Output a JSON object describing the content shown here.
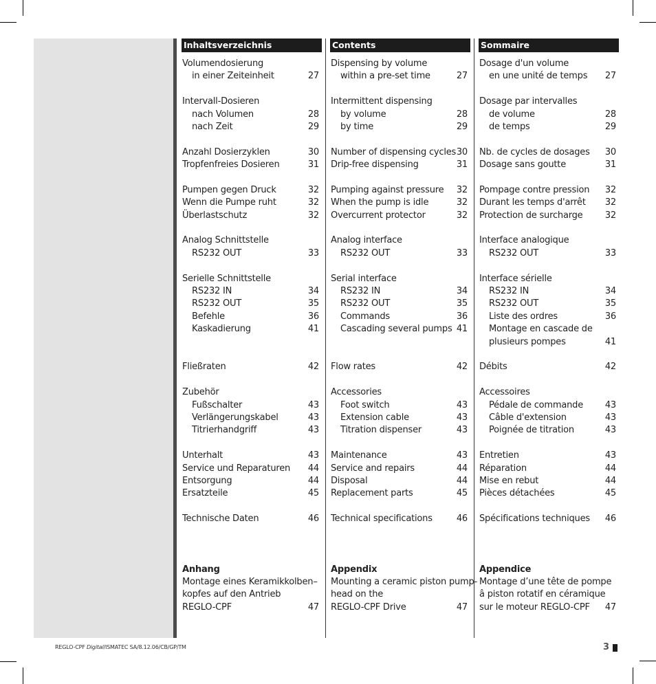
{
  "columns": [
    {
      "header": "Inhaltsverzeichnis",
      "rows": [
        {
          "text": "Volumendosierung",
          "page": ""
        },
        {
          "text": "in einer Zeiteinheit",
          "page": "27",
          "sub": true
        },
        {
          "gap": true
        },
        {
          "text": "Intervall-Dosieren",
          "page": ""
        },
        {
          "text": "nach Volumen",
          "page": "28",
          "sub": true
        },
        {
          "text": "nach Zeit",
          "page": "29",
          "sub": true
        },
        {
          "gap": true
        },
        {
          "text": "Anzahl Dosierzyklen",
          "page": "30"
        },
        {
          "text": "Tropfenfreies Dosieren",
          "page": "31"
        },
        {
          "gap": true
        },
        {
          "text": "Pumpen gegen Druck",
          "page": "32"
        },
        {
          "text": "Wenn die Pumpe ruht",
          "page": "32"
        },
        {
          "text": "Überlastschutz",
          "page": "32"
        },
        {
          "gap": true
        },
        {
          "text": "Analog Schnittstelle",
          "page": ""
        },
        {
          "text": "RS232 OUT",
          "page": "33",
          "sub": true
        },
        {
          "gap": true
        },
        {
          "text": "Serielle Schnittstelle",
          "page": ""
        },
        {
          "text": "RS232 IN",
          "page": "34",
          "sub": true
        },
        {
          "text": "RS232 OUT",
          "page": "35",
          "sub": true
        },
        {
          "text": "Befehle",
          "page": "36",
          "sub": true
        },
        {
          "text": "Kaskadierung",
          "page": "41",
          "sub": true
        },
        {
          "gap": true
        },
        {
          "gap": true
        },
        {
          "text": "Fließraten",
          "page": "42"
        },
        {
          "gap": true
        },
        {
          "text": "Zubehör",
          "page": ""
        },
        {
          "text": "Fußschalter",
          "page": "43",
          "sub": true
        },
        {
          "text": "Verlängerungskabel",
          "page": "43",
          "sub": true
        },
        {
          "text": "Titrierhandgriff",
          "page": "43",
          "sub": true
        },
        {
          "gap": true
        },
        {
          "text": "Unterhalt",
          "page": "43"
        },
        {
          "text": "Service und Reparaturen",
          "page": "44"
        },
        {
          "text": "Entsorgung",
          "page": "44"
        },
        {
          "text": "Ersatzteile",
          "page": "45"
        },
        {
          "gap": true
        },
        {
          "text": "Technische Daten",
          "page": "46"
        },
        {
          "gap": true
        },
        {
          "gap": true
        },
        {
          "gap": true
        },
        {
          "text": "Anhang",
          "page": "",
          "bold": true
        },
        {
          "text": "Montage eines Keramikkolben–",
          "page": ""
        },
        {
          "text": "kopfes auf den Antrieb",
          "page": ""
        },
        {
          "text": "REGLO-CPF",
          "page": "47"
        }
      ]
    },
    {
      "header": "Contents",
      "rows": [
        {
          "text": "Dispensing by volume",
          "page": ""
        },
        {
          "text": "within a pre-set time",
          "page": "27",
          "sub": true
        },
        {
          "gap": true
        },
        {
          "text": "Intermittent dispensing",
          "page": ""
        },
        {
          "text": "by volume",
          "page": "28",
          "sub": true
        },
        {
          "text": "by time",
          "page": "29",
          "sub": true
        },
        {
          "gap": true
        },
        {
          "text": "Number of dispensing cycles",
          "page": "30"
        },
        {
          "text": "Drip-free dispensing",
          "page": "31"
        },
        {
          "gap": true
        },
        {
          "text": "Pumping against pressure",
          "page": "32"
        },
        {
          "text": "When the pump is idle",
          "page": "32"
        },
        {
          "text": "Overcurrent protector",
          "page": "32"
        },
        {
          "gap": true
        },
        {
          "text": "Analog interface",
          "page": ""
        },
        {
          "text": "RS232 OUT",
          "page": "33",
          "sub": true
        },
        {
          "gap": true
        },
        {
          "text": "Serial interface",
          "page": ""
        },
        {
          "text": "RS232 IN",
          "page": "34",
          "sub": true
        },
        {
          "text": "RS232 OUT",
          "page": "35",
          "sub": true
        },
        {
          "text": "Commands",
          "page": "36",
          "sub": true
        },
        {
          "text": "Cascading several pumps",
          "page": "41",
          "sub": true
        },
        {
          "gap": true
        },
        {
          "gap": true
        },
        {
          "text": "Flow rates",
          "page": "42"
        },
        {
          "gap": true
        },
        {
          "text": "Accessories",
          "page": ""
        },
        {
          "text": "Foot switch",
          "page": "43",
          "sub": true
        },
        {
          "text": "Extension cable",
          "page": "43",
          "sub": true
        },
        {
          "text": "Titration dispenser",
          "page": "43",
          "sub": true
        },
        {
          "gap": true
        },
        {
          "text": "Maintenance",
          "page": "43"
        },
        {
          "text": "Service and repairs",
          "page": "44"
        },
        {
          "text": "Disposal",
          "page": "44"
        },
        {
          "text": "Replacement parts",
          "page": "45"
        },
        {
          "gap": true
        },
        {
          "text": "Technical specifications",
          "page": "46"
        },
        {
          "gap": true
        },
        {
          "gap": true
        },
        {
          "gap": true
        },
        {
          "text": "Appendix",
          "page": "",
          "bold": true
        },
        {
          "text": "Mounting a ceramic piston pump-",
          "page": ""
        },
        {
          "text": "head on the",
          "page": ""
        },
        {
          "text": "REGLO-CPF Drive",
          "page": "47"
        }
      ]
    },
    {
      "header": "Sommaire",
      "rows": [
        {
          "text": "Dosage d'un volume",
          "page": ""
        },
        {
          "text": "en une unité de temps",
          "page": "27",
          "sub": true
        },
        {
          "gap": true
        },
        {
          "text": "Dosage par intervalles",
          "page": ""
        },
        {
          "text": "de volume",
          "page": "28",
          "sub": true
        },
        {
          "text": "de temps",
          "page": "29",
          "sub": true
        },
        {
          "gap": true
        },
        {
          "text": "Nb. de cycles de dosages",
          "page": "30"
        },
        {
          "text": "Dosage sans goutte",
          "page": "31"
        },
        {
          "gap": true
        },
        {
          "text": "Pompage contre pression",
          "page": "32"
        },
        {
          "text": "Durant les temps d'arrêt",
          "page": "32"
        },
        {
          "text": "Protection de surcharge",
          "page": "32"
        },
        {
          "gap": true
        },
        {
          "text": "Interface analogique",
          "page": ""
        },
        {
          "text": "RS232 OUT",
          "page": "33",
          "sub": true
        },
        {
          "gap": true
        },
        {
          "text": "Interface sérielle",
          "page": ""
        },
        {
          "text": "RS232 IN",
          "page": "34",
          "sub": true
        },
        {
          "text": "RS232 OUT",
          "page": "35",
          "sub": true
        },
        {
          "text": "Liste des ordres",
          "page": "36",
          "sub": true
        },
        {
          "text": "Montage en cascade de",
          "page": "",
          "sub": true
        },
        {
          "text": "plusieurs pompes",
          "page": "41",
          "sub": true
        },
        {
          "gap": true
        },
        {
          "text": "Débits",
          "page": "42"
        },
        {
          "gap": true
        },
        {
          "text": "Accessoires",
          "page": ""
        },
        {
          "text": "Pédale de commande",
          "page": "43",
          "sub": true
        },
        {
          "text": "Câble d'extension",
          "page": "43",
          "sub": true
        },
        {
          "text": "Poignée de titration",
          "page": "43",
          "sub": true
        },
        {
          "gap": true
        },
        {
          "text": "Entretien",
          "page": "43"
        },
        {
          "text": "Réparation",
          "page": "44"
        },
        {
          "text": "Mise en rebut",
          "page": "44"
        },
        {
          "text": "Pièces détachées",
          "page": "45"
        },
        {
          "gap": true
        },
        {
          "text": "Spécifications techniques",
          "page": "46"
        },
        {
          "gap": true
        },
        {
          "gap": true
        },
        {
          "gap": true
        },
        {
          "text": "Appendice",
          "page": "",
          "bold": true
        },
        {
          "text": "Montage d’une tête de pompe",
          "page": ""
        },
        {
          "text": "â piston rotatif en céramique",
          "page": ""
        },
        {
          "text": "sur le moteur REGLO-CPF",
          "page": "47"
        }
      ]
    }
  ],
  "footer": {
    "prefix": "REGLO-CPF ",
    "italic": "Digital",
    "suffix": "/ISMATEC SA/8.12.06/CB/GP/TM"
  },
  "page_number": "3"
}
